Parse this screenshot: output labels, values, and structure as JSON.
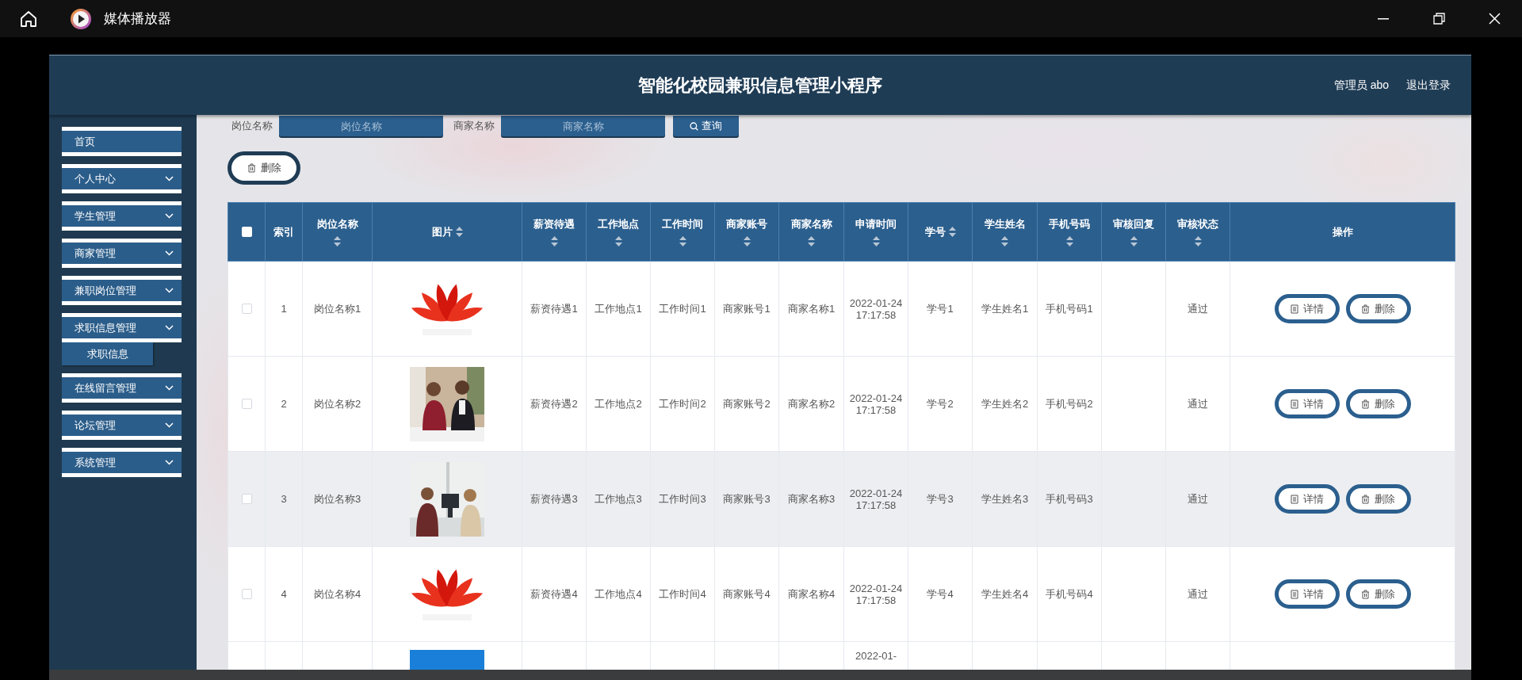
{
  "player": {
    "title": "媒体播放器"
  },
  "app": {
    "title": "智能化校园兼职信息管理小程序",
    "user": "管理员 abo",
    "logout": "退出登录"
  },
  "sidebar": {
    "items": [
      {
        "label": "首页",
        "kind": "link"
      },
      {
        "label": "个人中心",
        "kind": "menu"
      },
      {
        "label": "学生管理",
        "kind": "menu"
      },
      {
        "label": "商家管理",
        "kind": "menu"
      },
      {
        "label": "兼职岗位管理",
        "kind": "menu"
      },
      {
        "label": "求职信息管理",
        "kind": "menu",
        "children": [
          {
            "label": "求职信息"
          }
        ]
      },
      {
        "label": "在线留言管理",
        "kind": "menu"
      },
      {
        "label": "论坛管理",
        "kind": "menu"
      },
      {
        "label": "系统管理",
        "kind": "menu"
      }
    ]
  },
  "search": {
    "fields": [
      {
        "label": "岗位名称",
        "placeholder": "岗位名称"
      },
      {
        "label": "商家名称",
        "placeholder": "商家名称"
      }
    ],
    "button": "查询"
  },
  "toolbar": {
    "delete_button": "删除"
  },
  "table": {
    "select_all": {
      "checked": false
    },
    "columns": [
      {
        "label": "索引",
        "sortable": false
      },
      {
        "label": "岗位名称",
        "sortable": true
      },
      {
        "label": "图片",
        "sortable": true
      },
      {
        "label": "薪资待遇",
        "sortable": true
      },
      {
        "label": "工作地点",
        "sortable": true
      },
      {
        "label": "工作时间",
        "sortable": true
      },
      {
        "label": "商家账号",
        "sortable": true
      },
      {
        "label": "商家名称",
        "sortable": true
      },
      {
        "label": "申请时间",
        "sortable": true
      },
      {
        "label": "学号",
        "sortable": true
      },
      {
        "label": "学生姓名",
        "sortable": true
      },
      {
        "label": "手机号码",
        "sortable": true
      },
      {
        "label": "审核回复",
        "sortable": true
      },
      {
        "label": "审核状态",
        "sortable": true
      },
      {
        "label": "操作",
        "sortable": false
      }
    ],
    "rows": [
      {
        "checked": false,
        "highlighted": false,
        "cells": [
          "1",
          "岗位名称1",
          {
            "kind": "picture"
          },
          "薪资待遇1",
          "工作地点1",
          "工作时间1",
          "商家账号1",
          "商家名称1",
          "2022-01-24 17:17:58",
          "学号1",
          "学生姓名1",
          "手机号码1",
          "",
          "通过"
        ],
        "actions": [
          "详情",
          "删除"
        ]
      },
      {
        "checked": false,
        "highlighted": false,
        "cells": [
          "2",
          "岗位名称2",
          {
            "kind": "picture"
          },
          "薪资待遇2",
          "工作地点2",
          "工作时间2",
          "商家账号2",
          "商家名称2",
          "2022-01-24 17:17:58",
          "学号2",
          "学生姓名2",
          "手机号码2",
          "",
          "通过"
        ],
        "actions": [
          "详情",
          "删除"
        ]
      },
      {
        "checked": false,
        "highlighted": true,
        "cells": [
          "3",
          "岗位名称3",
          {
            "kind": "picture"
          },
          "薪资待遇3",
          "工作地点3",
          "工作时间3",
          "商家账号3",
          "商家名称3",
          "2022-01-24 17:17:58",
          "学号3",
          "学生姓名3",
          "手机号码3",
          "",
          "通过"
        ],
        "actions": [
          "详情",
          "删除"
        ]
      },
      {
        "checked": false,
        "highlighted": false,
        "cells": [
          "4",
          "岗位名称4",
          {
            "kind": "picture"
          },
          "薪资待遇4",
          "工作地点4",
          "工作时间4",
          "商家账号4",
          "商家名称4",
          "2022-01-24 17:17:58",
          "学号4",
          "学生姓名4",
          "手机号码4",
          "",
          "通过"
        ],
        "actions": [
          "详情",
          "删除"
        ]
      },
      {
        "highlighted": false,
        "cells": [
          "",
          "",
          {
            "kind": "picture"
          },
          "",
          "",
          "",
          "",
          "",
          "2022-01-",
          "",
          "",
          "",
          "",
          ""
        ]
      }
    ]
  }
}
